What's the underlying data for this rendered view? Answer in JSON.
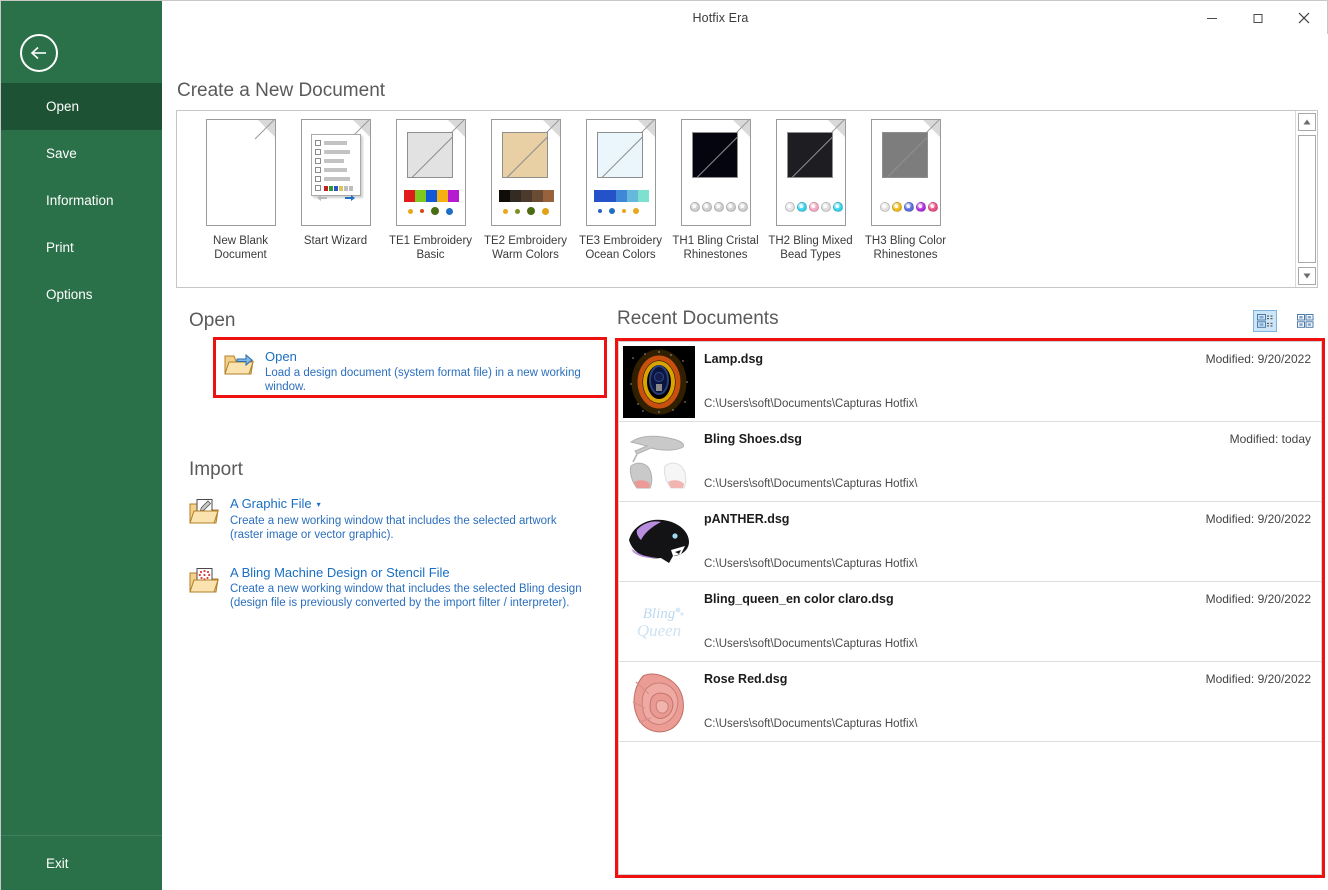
{
  "window": {
    "title": "Hotfix Era",
    "minimize_label": "─",
    "maximize_label": "□",
    "close_label": "✕"
  },
  "sidebar": {
    "back_label": "Back",
    "items": [
      {
        "label": "Open",
        "active": true
      },
      {
        "label": "Save",
        "active": false
      },
      {
        "label": "Information",
        "active": false
      },
      {
        "label": "Print",
        "active": false
      },
      {
        "label": "Options",
        "active": false
      }
    ],
    "exit_label": "Exit",
    "accent": "#2a7049",
    "accent_active": "#1d5234"
  },
  "create": {
    "heading": "Create a New Document",
    "templates": [
      {
        "id": "new-blank-document",
        "label": "New Blank Document",
        "kind": "blank"
      },
      {
        "id": "start-wizard",
        "label": "Start Wizard",
        "kind": "wizard",
        "wizard_rows": [
          "Author",
          "Palettes",
          "Hoop",
          "Images",
          "Material",
          ""
        ],
        "wizard_checked": [
          true,
          true,
          true,
          false,
          false,
          false
        ]
      },
      {
        "id": "te1-embroidery-basic",
        "label": "TE1 Embroidery Basic",
        "kind": "embroidery",
        "art_fill": "#e2e2e2",
        "swatches": [
          "#e01b1b",
          "#7ec820",
          "#1358d8",
          "#f5b111",
          "#b51bd0"
        ],
        "dots": [
          {
            "color": "#e8a81a",
            "size": 5
          },
          {
            "color": "#d04a18",
            "size": 4
          },
          {
            "color": "#4a6b12",
            "size": 8
          },
          {
            "color": "#1f6fc4",
            "size": 7
          }
        ]
      },
      {
        "id": "te2-embroidery-warm-colors",
        "label": "TE2 Embroidery Warm Colors",
        "kind": "embroidery",
        "art_fill": "#e8cfa4",
        "swatches": [
          "#100c08",
          "#342b22",
          "#4c3a2d",
          "#6a4b33",
          "#97623c"
        ],
        "dots": [
          {
            "color": "#e8a81a",
            "size": 5
          },
          {
            "color": "#7d8f1e",
            "size": 5
          },
          {
            "color": "#4a6b12",
            "size": 8
          },
          {
            "color": "#e0a317",
            "size": 7
          }
        ]
      },
      {
        "id": "te3-embroidery-ocean-colors",
        "label": "TE3 Embroidery Ocean Colors",
        "kind": "embroidery",
        "art_fill": "#eaf6fb",
        "swatches": [
          "#2453c9",
          "#2453c9",
          "#3f88d8",
          "#64b9dd",
          "#7ee0cf"
        ],
        "dots": [
          {
            "color": "#2b5fc6",
            "size": 4
          },
          {
            "color": "#1f6fc4",
            "size": 6
          },
          {
            "color": "#e8a81a",
            "size": 4
          },
          {
            "color": "#e8a81a",
            "size": 6
          }
        ]
      },
      {
        "id": "th1-bling-cristal-rhinestones",
        "label": "TH1 Bling Cristal Rhinestones",
        "kind": "bling",
        "art_fill": "#050510",
        "beads": [
          "#cfcfcf",
          "#cfcfcf",
          "#cfcfcf",
          "#cfcfcf",
          "#cfcfcf"
        ]
      },
      {
        "id": "th2-bling-mixed-bead-types",
        "label": "TH2 Bling Mixed Bead Types",
        "kind": "bling",
        "art_fill": "#1e1e22",
        "beads": [
          "#e3e3e3",
          "#35d4ee",
          "#f2a9c4",
          "#dcdcdc",
          "#35d4ee"
        ]
      },
      {
        "id": "th3-bling-color-rhinestones",
        "label": "TH3 Bling Color Rhinestones",
        "kind": "bling",
        "art_fill": "#7d7d7d",
        "beads": [
          "#e3e3e3",
          "#f0bb16",
          "#5a6fe0",
          "#b42ce0",
          "#ea4f86"
        ]
      }
    ],
    "scrollbar": {
      "up": "▲",
      "down": "▼"
    }
  },
  "open": {
    "heading": "Open",
    "command": {
      "icon": "open-folder-icon",
      "title": "Open",
      "description": "Load a design document (system format file) in a new working window."
    },
    "highlight_color": "#ee1111"
  },
  "import": {
    "heading": "Import",
    "commands": [
      {
        "icon": "graphic-file-folder-icon",
        "title": "A Graphic File",
        "has_caret": true,
        "caret": "▾",
        "description": "Create a new working window that includes the selected artwork (raster image or vector graphic)."
      },
      {
        "icon": "bling-design-folder-icon",
        "title": "A Bling Machine Design or Stencil File",
        "has_caret": false,
        "caret": "",
        "description": "Create a new working window that includes the selected Bling design (design file is previously converted by the import filter / interpreter)."
      }
    ]
  },
  "recent": {
    "heading": "Recent Documents",
    "view_modes": [
      {
        "id": "details-view-icon",
        "label": "Details view",
        "selected": true
      },
      {
        "id": "tiles-view-icon",
        "label": "Tiles view",
        "selected": false
      }
    ],
    "highlight_color": "#ee1111",
    "documents": [
      {
        "name": "Lamp.dsg",
        "path": "C:\\Users\\soft\\Documents\\Capturas Hotfix\\",
        "modified": "Modified: 9/20/2022",
        "thumb": "lamp"
      },
      {
        "name": "Bling Shoes.dsg",
        "path": "C:\\Users\\soft\\Documents\\Capturas Hotfix\\",
        "modified": "Modified: today",
        "thumb": "shoes"
      },
      {
        "name": "pANTHER.dsg",
        "path": "C:\\Users\\soft\\Documents\\Capturas Hotfix\\",
        "modified": "Modified: 9/20/2022",
        "thumb": "panther"
      },
      {
        "name": "Bling_queen_en color claro.dsg",
        "path": "C:\\Users\\soft\\Documents\\Capturas Hotfix\\",
        "modified": "Modified: 9/20/2022",
        "thumb": "blingqueen"
      },
      {
        "name": "Rose Red.dsg",
        "path": "C:\\Users\\soft\\Documents\\Capturas Hotfix\\",
        "modified": "Modified: 9/20/2022",
        "thumb": "rose"
      }
    ]
  }
}
